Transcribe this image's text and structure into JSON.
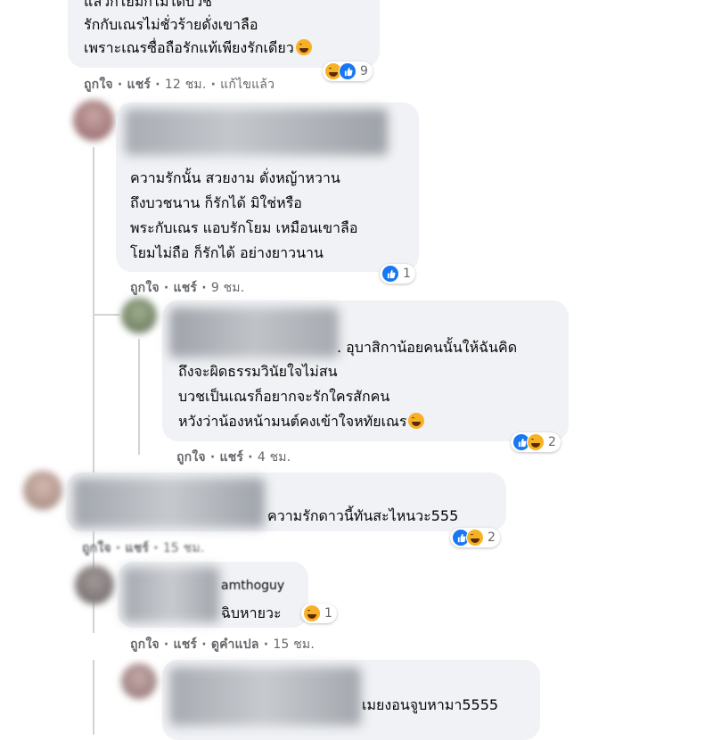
{
  "comments": [
    {
      "id": "c1",
      "lines": [
        "แล้วก็โยมก็ไม่ได้บวช",
        "รักกับเณรไม่ชั่วร้ายดั่งเขาลือ",
        "เพราะเณรซื่อถือรักแท้เพียงรักเดียว"
      ],
      "reactions": {
        "count": "9",
        "types": [
          "haha-icon",
          "like-icon"
        ]
      },
      "actions": {
        "like": "ถูกใจ",
        "share": "แชร์",
        "time": "12 ชม.",
        "edited": "แก้ไขแล้ว"
      }
    },
    {
      "id": "c2",
      "lines": [
        "ความรักนั้น สวยงาม ดั่งหญ้าหวาน",
        "ถึงบวชนาน ก็รักได้ มิใช่หรือ",
        "พระกับเณร แอบรักโยม เหมือนเขาลือ",
        "โยมไม่ถือ ก็รักได้ อย่างยาวนาน"
      ],
      "reactions": {
        "count": "1",
        "types": [
          "like-icon"
        ]
      },
      "actions": {
        "like": "ถูกใจ",
        "share": "แชร์",
        "time": "9 ชม."
      }
    },
    {
      "id": "c3",
      "lines": [
        ". อุบาสิกาน้อยคนนั้นให้ฉันคิด",
        "ถึงจะผิดธรรมวินัยใจไม่สน",
        "บวชเป็นเณรก็อยากจะรักใครสักคน",
        "หวังว่าน้องหน้ามนต์คงเข้าใจหทัยเณร"
      ],
      "reactions": {
        "count": "2",
        "types": [
          "like-icon",
          "haha-icon"
        ]
      },
      "actions": {
        "like": "ถูกใจ",
        "share": "แชร์",
        "time": "4 ชม."
      }
    },
    {
      "id": "c4",
      "lines": [
        "ความรักดาวนี้ทันสะไหนวะ555"
      ],
      "reactions": {
        "count": "2",
        "types": [
          "like-icon",
          "haha-icon"
        ]
      },
      "actions": {
        "like": "ถูกใจ",
        "share": "แชร์",
        "time": "15 ชม."
      }
    },
    {
      "id": "c5",
      "lines": [
        "amthoguy",
        "ฉิบหายวะ"
      ],
      "reactions": {
        "count": "1",
        "types": [
          "haha-icon"
        ]
      },
      "actions": {
        "like": "ถูกใจ",
        "share": "แชร์",
        "translate": "ดูคำแปล",
        "time": "15 ชม."
      }
    },
    {
      "id": "c6",
      "lines": [
        "เมยงอนจูบหามา5555"
      ]
    }
  ],
  "separator": "·",
  "colors": {
    "bubble": "#f0f2f5",
    "like": "#1877f2",
    "haha": "#f7b125",
    "meta": "#65676b"
  }
}
